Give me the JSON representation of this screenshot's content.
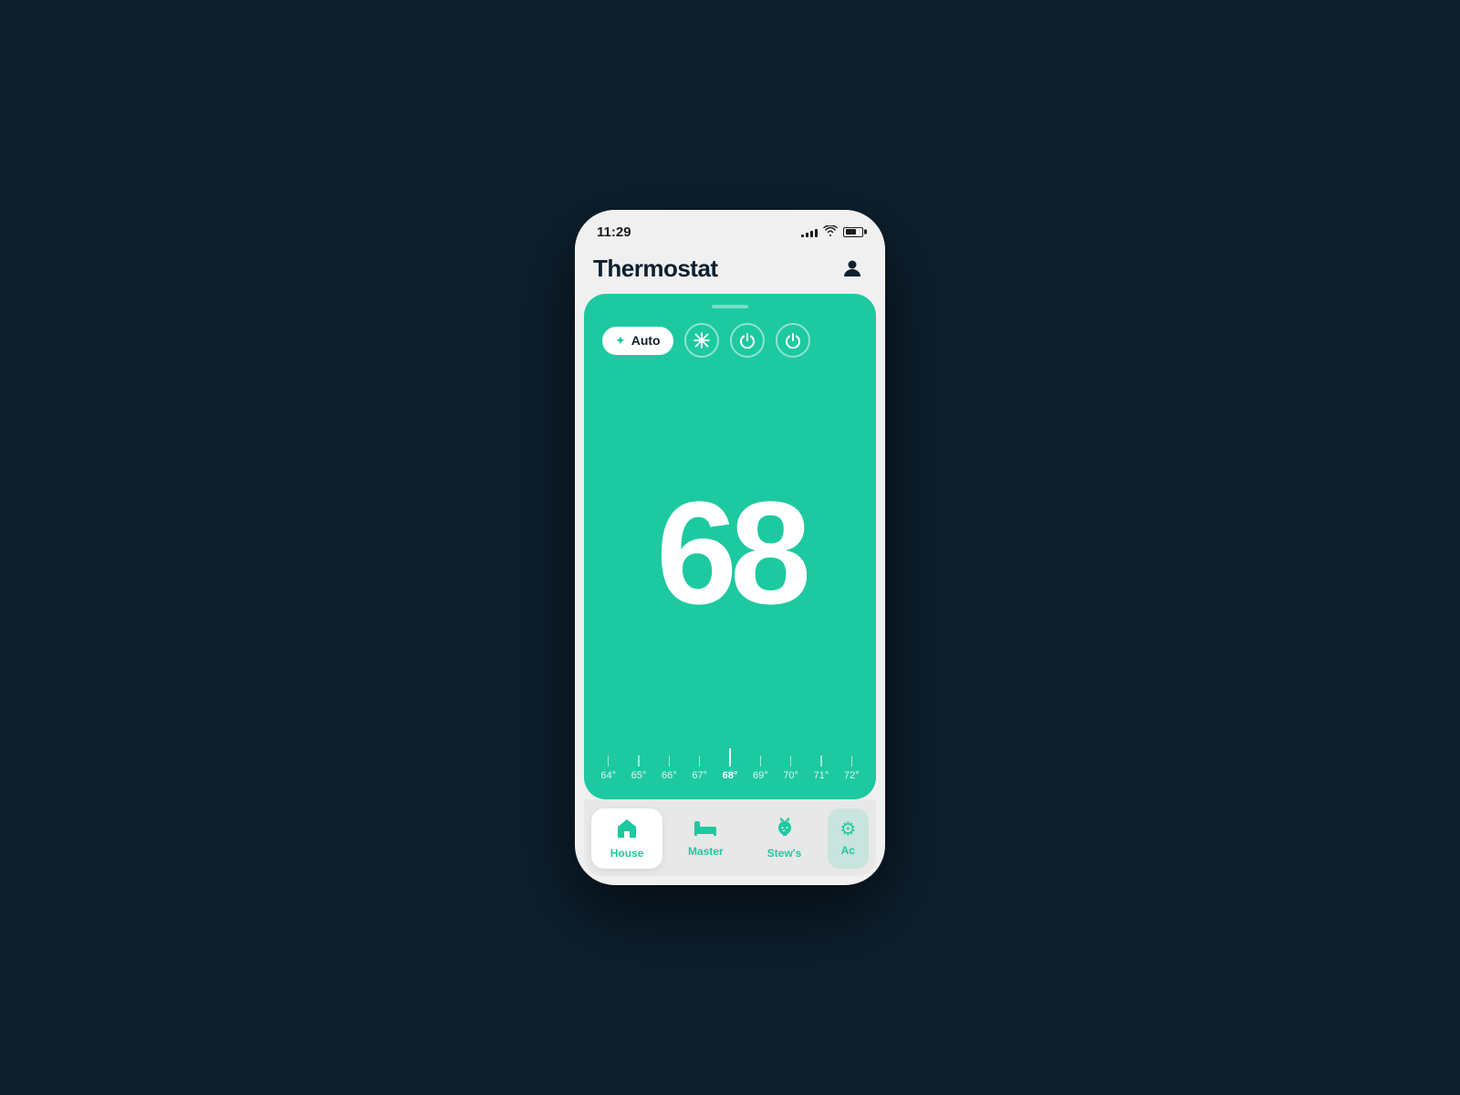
{
  "statusBar": {
    "time": "11:29",
    "signalBars": [
      3,
      5,
      7,
      9,
      11
    ],
    "batteryLevel": 70
  },
  "header": {
    "title": "Thermostat",
    "profileLabel": "profile"
  },
  "thermostat": {
    "temperature": "68",
    "modeButtons": {
      "auto": "Auto",
      "snow": "❄",
      "halfPower": "half-power",
      "power": "power"
    },
    "tickMarks": [
      {
        "label": "64°",
        "active": false
      },
      {
        "label": "65°",
        "active": false
      },
      {
        "label": "66°",
        "active": false
      },
      {
        "label": "67°",
        "active": false
      },
      {
        "label": "68°",
        "active": true
      },
      {
        "label": "69°",
        "active": false
      },
      {
        "label": "70°",
        "active": false
      },
      {
        "label": "71°",
        "active": false
      },
      {
        "label": "72°",
        "active": false
      }
    ]
  },
  "navItems": [
    {
      "id": "house",
      "label": "House",
      "icon": "🏠",
      "active": true
    },
    {
      "id": "master",
      "label": "Master",
      "icon": "🛏",
      "active": false
    },
    {
      "id": "stews",
      "label": "Stew's",
      "icon": "🐱",
      "active": false
    },
    {
      "id": "ac",
      "label": "Ac",
      "icon": "●",
      "active": false,
      "partial": true
    }
  ],
  "colors": {
    "teal": "#1dc9a0",
    "dark": "#0d1f2d",
    "background": "#0d1f2d",
    "phoneShell": "#f0f0f0"
  }
}
